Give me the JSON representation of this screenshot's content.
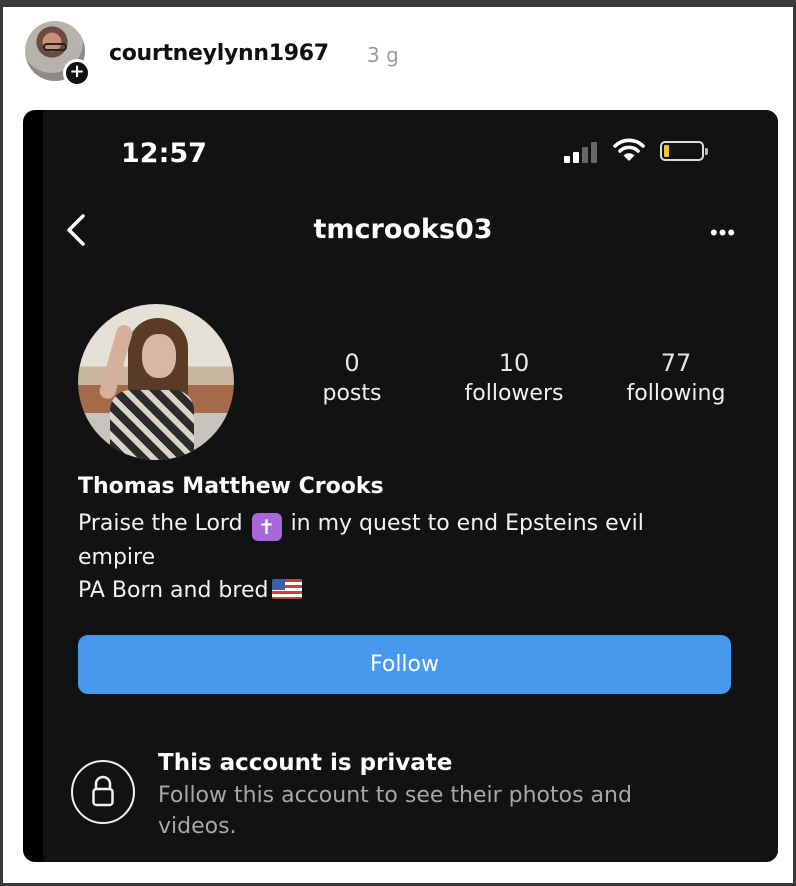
{
  "post": {
    "username": "courtneylynn1967",
    "age": "3 g",
    "add_badge": "+"
  },
  "status_bar": {
    "time": "12:57"
  },
  "profile": {
    "username": "tmcrooks03",
    "more": "•••",
    "stats": [
      {
        "value": "0",
        "label": "posts"
      },
      {
        "value": "10",
        "label": "followers"
      },
      {
        "value": "77",
        "label": "following"
      }
    ],
    "full_name": "Thomas Matthew Crooks",
    "bio_line1_a": "Praise the Lord",
    "bio_cross": "✝",
    "bio_line1_b": "in my quest to end Epsteins evil",
    "bio_line2": "empire",
    "bio_line3": "PA Born and bred",
    "follow_label": "Follow",
    "private_title": "This account is private",
    "private_desc": "Follow this account to see their photos and videos."
  },
  "colors": {
    "follow_button": "#4799ee",
    "phone_bg": "#111214",
    "secondary_text": "#a7a7a7"
  },
  "icons": [
    "back-icon",
    "more-icon",
    "lock-icon",
    "signal-icon",
    "wifi-icon",
    "battery-icon",
    "cross-emoji",
    "us-flag-emoji"
  ]
}
